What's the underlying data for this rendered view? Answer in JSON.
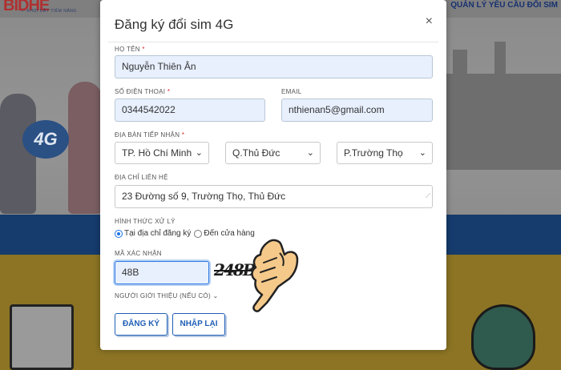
{
  "background": {
    "logo": "BIDHE",
    "tagline": "— KHƠI DẬY TIỀM NĂNG",
    "nav": "QUẢN LÝ YÊU CẦU ĐỔI SIM",
    "badge_4g": "4G"
  },
  "modal": {
    "title": "Đăng ký đổi sim 4G",
    "close": "×",
    "fields": {
      "name": {
        "label": "HỌ TÊN",
        "value": "Nguyễn Thiên Ân"
      },
      "phone": {
        "label": "SỐ ĐIỆN THOẠI",
        "value": "0344542022"
      },
      "email": {
        "label": "EMAIL",
        "value": "nthienan5@gmail.com"
      },
      "area": {
        "label": "ĐỊA BÀN TIẾP NHẬN",
        "city": "TP. Hồ Chí Minh",
        "district": "Q.Thủ Đức",
        "ward": "P.Trường Thọ"
      },
      "address": {
        "label": "ĐỊA CHỈ LIÊN HỆ",
        "value": "23 Đường số 9, Trường Thọ, Thủ Đức"
      },
      "method": {
        "label": "HÌNH THỨC XỬ LÝ",
        "option1": "Tại địa chỉ đăng ký",
        "option2": "Đến cửa hàng"
      },
      "captcha": {
        "label": "MÃ XÁC NHẬN",
        "value": "48B",
        "image_text": "248B"
      },
      "referrer": {
        "label": "NGƯỜI GIỚI THIỆU (NẾU CÓ)"
      }
    },
    "buttons": {
      "submit": "ĐĂNG KÝ",
      "reset": "NHẬP LẠI"
    }
  },
  "colors": {
    "accent": "#1f5fb6",
    "required": "#d62828",
    "input_fill": "#e8f0fe"
  }
}
